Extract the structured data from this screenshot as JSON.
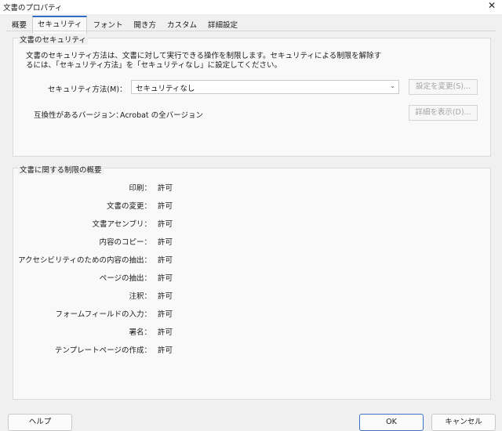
{
  "window": {
    "title": "文書のプロパティ",
    "close_glyph": "✕"
  },
  "tabs": [
    {
      "label": "概要"
    },
    {
      "label": "セキュリティ",
      "active": true
    },
    {
      "label": "フォント"
    },
    {
      "label": "開き方"
    },
    {
      "label": "カスタム"
    },
    {
      "label": "詳細設定"
    }
  ],
  "security": {
    "legend": "文書のセキュリティ",
    "desc_line1": "文書のセキュリティ方法は、文書に対して実行できる操作を制限します。セキュリティによる制限を解除す",
    "desc_line2": "るには、「セキュリティ方法」を「セキュリティなし」に設定してください。",
    "method_label": "セキュリティ方法(M)：",
    "method_value": "セキュリティなし",
    "change_button": "設定を変更(S)...",
    "compat_label": "互換性があるバージョン：",
    "compat_value": "Acrobat の全バージョン",
    "details_button": "詳細を表示(D)..."
  },
  "restrictions": {
    "legend": "文書に関する制限の概要",
    "rows": [
      {
        "key": "印刷：",
        "value": "許可"
      },
      {
        "key": "文書の変更：",
        "value": "許可"
      },
      {
        "key": "文書アセンブリ：",
        "value": "許可"
      },
      {
        "key": "内容のコピー：",
        "value": "許可"
      },
      {
        "key": "アクセシビリティのための内容の抽出：",
        "value": "許可"
      },
      {
        "key": "ページの抽出：",
        "value": "許可"
      },
      {
        "key": "注釈：",
        "value": "許可"
      },
      {
        "key": "フォームフィールドの入力：",
        "value": "許可"
      },
      {
        "key": "署名：",
        "value": "許可"
      },
      {
        "key": "テンプレートページの作成：",
        "value": "許可"
      }
    ]
  },
  "footer": {
    "help": "ヘルプ",
    "ok": "OK",
    "cancel": "キャンセル"
  },
  "colors": {
    "accent": "#2f6dc7",
    "disabled_text": "#a3a3a3"
  }
}
